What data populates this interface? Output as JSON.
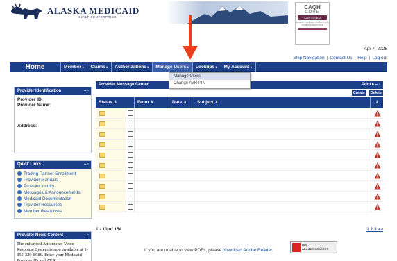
{
  "brand": {
    "title": "ALASKA MEDICAID",
    "subtitle": "HEALTH ENTERPRISE"
  },
  "caqh": {
    "title": "CAQH",
    "core": "CORE",
    "certified": "CERTIFIED",
    "body": "ELIGIBILITY & BENEFITS CLAIM STATUS PAYMENT & REMITTANCE"
  },
  "header": {
    "date": "Apr 7, 2026",
    "links": [
      "Skip Navigation",
      "Contact Us",
      "Help",
      "Log out"
    ]
  },
  "nav": {
    "home": "Home",
    "items": [
      "Member",
      "Claims",
      "Authorizations",
      "Manage Users",
      "Lookups",
      "My Account"
    ]
  },
  "dropdown": {
    "items": [
      "Manage Users",
      "Change AVR PIN"
    ]
  },
  "provider_id": {
    "title": "Provider Identification",
    "controls": "– ▫",
    "id_label": "Provider ID:",
    "name_label": "Provider Name:",
    "address_label": "Address:"
  },
  "quick_links": {
    "title": "Quick Links",
    "controls": "– ▫",
    "items": [
      "Trading Partner Enrollment",
      "Provider Manuals",
      "Provider Inquiry",
      "Messages & Announcements",
      "Medicaid Documentation",
      "Provider Resources",
      "Member Resources"
    ]
  },
  "news": {
    "title": "Provider News Content",
    "controls": "– ▫",
    "text": "The enhanced Automated Voice Response System is now available at 1-855-329-8986. Enter your Medicaid Provider ID and AVR"
  },
  "message_center": {
    "title": "Provider Message Center",
    "print": "Print ▸ – ▫",
    "create": "Create",
    "delete": "Delete",
    "columns": [
      "Status",
      "From",
      "Date",
      "Subject"
    ],
    "row_count": 10,
    "pager_left": "1 - 10 of 154",
    "pager_right": "1 2 3 >>",
    "pdf_prefix": "If you are unable to view PDFs, please ",
    "pdf_link": "download Adobe Reader.",
    "adobe_get": "Get",
    "adobe_name": "ADOBE® READER®"
  },
  "colors": {
    "nav": "#1c3f8a",
    "link": "#1a4fa0",
    "arrow": "#e8401c"
  }
}
